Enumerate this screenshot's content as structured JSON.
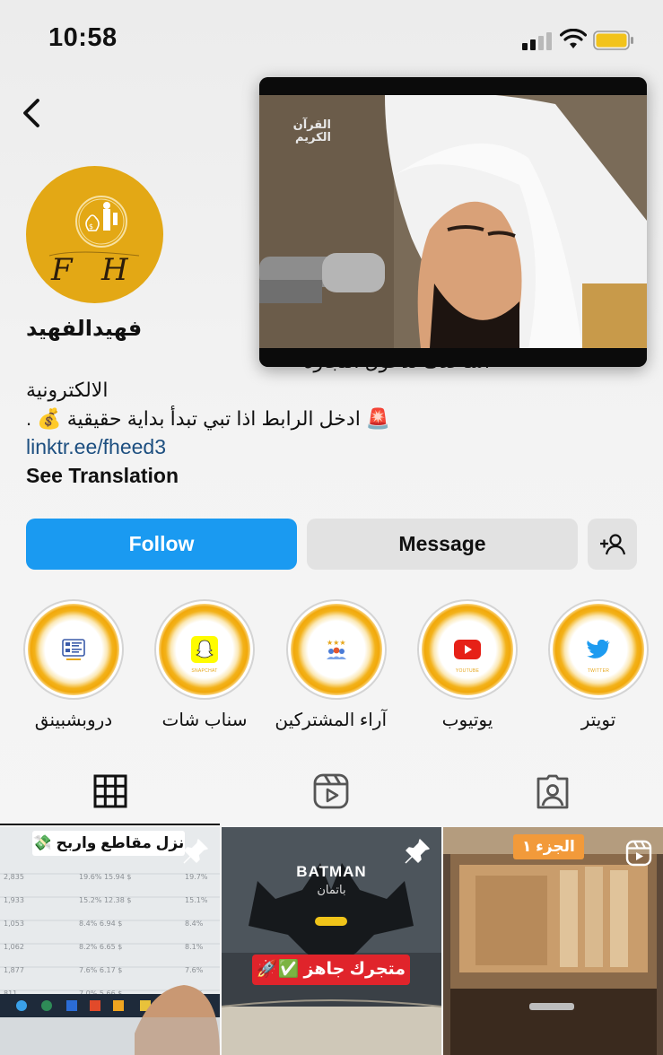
{
  "status_bar": {
    "time": "10:58",
    "battery_color": "#f2c31b"
  },
  "nav": {
    "back_icon": "chevron-left-icon"
  },
  "profile": {
    "avatar_letters": "F   H",
    "name": "فهيدالفهيد",
    "bio_line1": "اساعدك لدخول التجارة",
    "bio_line2": "الالكترونية",
    "bio_line3": "🚨 ادخل الرابط اذا تبي تبدأ بداية حقيقية 💰 .",
    "link": "linktr.ee/fheed3",
    "see_translation": "See Translation"
  },
  "pip_video": {
    "channel_text": "القرآن الكريم"
  },
  "actions": {
    "follow": "Follow",
    "message": "Message",
    "add_user_icon": "add-user-icon",
    "follow_color": "#1a9af1"
  },
  "highlights": [
    {
      "label": "دروبشبينق",
      "icon": "dropshipping-icon"
    },
    {
      "label": "سناب شات",
      "icon": "snapchat-icon",
      "sub": "SNAPCHAT"
    },
    {
      "label": "آراء المشتركين",
      "icon": "reviews-icon"
    },
    {
      "label": "يوتيوب",
      "icon": "youtube-icon",
      "sub": "YOUTUBE"
    },
    {
      "label": "تويتر",
      "icon": "twitter-icon",
      "sub": "TWITTER"
    }
  ],
  "tabs": [
    {
      "name": "grid",
      "icon": "grid-icon"
    },
    {
      "name": "reels",
      "icon": "reels-icon"
    },
    {
      "name": "tagged",
      "icon": "tagged-icon"
    }
  ],
  "posts": [
    {
      "caption": "نزل مقاطع واربح 💸",
      "pinned": true
    },
    {
      "title": "BATMAN",
      "subtitle": "باتمان",
      "caption": "متجرك جاهز ✅🚀",
      "pinned": true
    },
    {
      "badge": "الجزء ١",
      "reel": true
    }
  ]
}
